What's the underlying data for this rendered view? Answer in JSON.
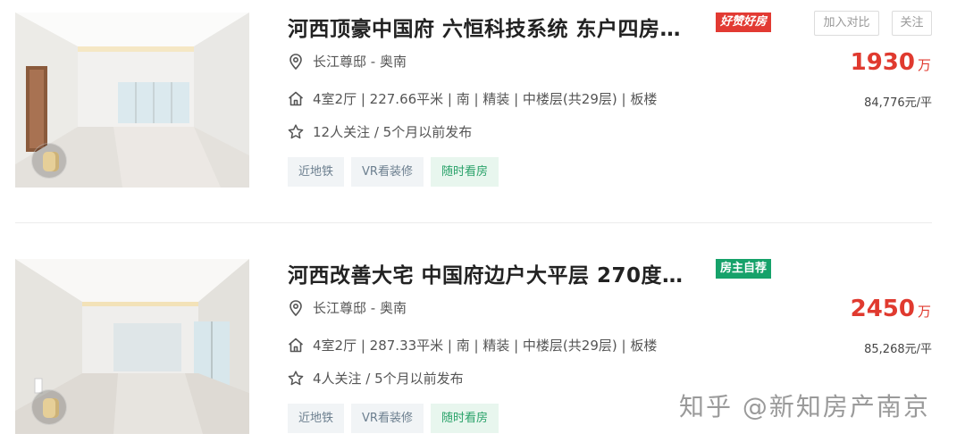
{
  "listings": [
    {
      "title": "河西顶豪中国府 六恒科技系统 东户四房…",
      "badge": "好赞好房",
      "compare_label": "加入对比",
      "follow_label": "关注",
      "location": "长江尊邸 - 奥南",
      "house_info": "4室2厅 | 227.66平米 | 南 | 精装 | 中楼层(共29层) | 板楼",
      "follow_info": "12人关注 / 5个月以前发布",
      "tags": [
        "近地铁",
        "VR看装修",
        "随时看房"
      ],
      "price": "1930",
      "price_unit": "万",
      "unit_price": "84,776元/平"
    },
    {
      "title": "河西改善大宅 中国府边户大平层 270度…",
      "badge": "房主自荐",
      "location": "长江尊邸 - 奥南",
      "house_info": "4室2厅 | 287.33平米 | 南 | 精装 | 中楼层(共29层) | 板楼",
      "follow_info": "4人关注 / 5个月以前发布",
      "tags": [
        "近地铁",
        "VR看装修",
        "随时看房"
      ],
      "price": "2450",
      "price_unit": "万",
      "unit_price": "85,268元/平"
    }
  ],
  "watermark": "知乎 @新知房产南京",
  "colors": {
    "price_red": "#e03a2f",
    "badge_red": "#e23a33",
    "badge_green": "#16a26a",
    "tag_green_text": "#2aa26a"
  },
  "icons": {
    "location": "location-pin-icon",
    "house": "house-icon",
    "follow": "star-icon"
  }
}
